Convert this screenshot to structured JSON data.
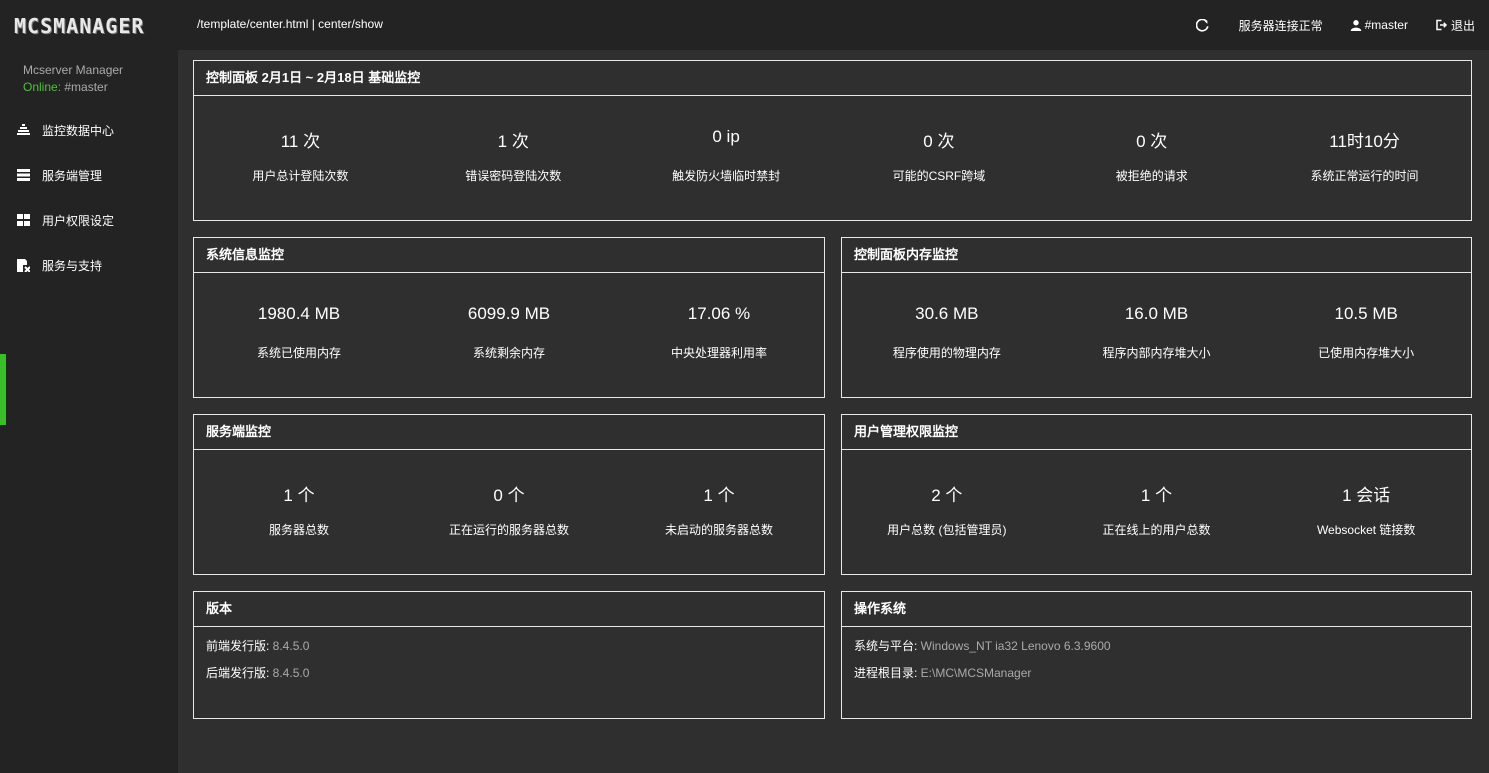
{
  "header": {
    "logo": "MCSMANAGER",
    "breadcrumb": "/template/center.html | center/show",
    "status": "服务器连接正常",
    "user": "#master",
    "logout": "退出"
  },
  "sidebar": {
    "subtitle": "Mcserver Manager",
    "online_label": "Online:",
    "online_user": " #master",
    "items": [
      {
        "label": "监控数据中心",
        "icon": "bar-chart-icon"
      },
      {
        "label": "服务端管理",
        "icon": "server-icon"
      },
      {
        "label": "用户权限设定",
        "icon": "grid-icon"
      },
      {
        "label": "服务与支持",
        "icon": "support-icon"
      }
    ]
  },
  "panels": {
    "overview": {
      "title": "控制面板 2月1日 ~ 2月18日 基础监控",
      "stats": [
        {
          "value": "11 次",
          "label": "用户总计登陆次数"
        },
        {
          "value": "1 次",
          "label": "错误密码登陆次数"
        },
        {
          "value": "0 ip",
          "label": "触发防火墙临时禁封"
        },
        {
          "value": "0 次",
          "label": "可能的CSRF跨域"
        },
        {
          "value": "0 次",
          "label": "被拒绝的请求"
        },
        {
          "value": "11时10分",
          "label": "系统正常运行的时间"
        }
      ]
    },
    "system": {
      "title": "系统信息监控",
      "stats": [
        {
          "value": "1980.4 MB",
          "label": "系统已使用内存"
        },
        {
          "value": "6099.9 MB",
          "label": "系统剩余内存"
        },
        {
          "value": "17.06 %",
          "label": "中央处理器利用率"
        }
      ]
    },
    "memory": {
      "title": "控制面板内存监控",
      "stats": [
        {
          "value": "30.6 MB",
          "label": "程序使用的物理内存"
        },
        {
          "value": "16.0 MB",
          "label": "程序内部内存堆大小"
        },
        {
          "value": "10.5 MB",
          "label": "已使用内存堆大小"
        }
      ]
    },
    "servers": {
      "title": "服务端监控",
      "stats": [
        {
          "value": "1 个",
          "label": "服务器总数"
        },
        {
          "value": "0 个",
          "label": "正在运行的服务器总数"
        },
        {
          "value": "1 个",
          "label": "未启动的服务器总数"
        }
      ]
    },
    "users": {
      "title": "用户管理权限监控",
      "stats": [
        {
          "value": "2 个",
          "label": "用户总数 (包括管理员)"
        },
        {
          "value": "1 个",
          "label": "正在线上的用户总数"
        },
        {
          "value": "1 会话",
          "label": "Websocket 链接数"
        }
      ]
    },
    "version": {
      "title": "版本",
      "rows": [
        {
          "key": "前端发行版: ",
          "value": "8.4.5.0"
        },
        {
          "key": "后端发行版: ",
          "value": "8.4.5.0"
        }
      ]
    },
    "os": {
      "title": "操作系统",
      "rows": [
        {
          "key": "系统与平台: ",
          "value": "Windows_NT ia32 Lenovo 6.3.9600"
        },
        {
          "key": "进程根目录: ",
          "value": "E:\\MC\\MCSManager"
        }
      ]
    }
  }
}
